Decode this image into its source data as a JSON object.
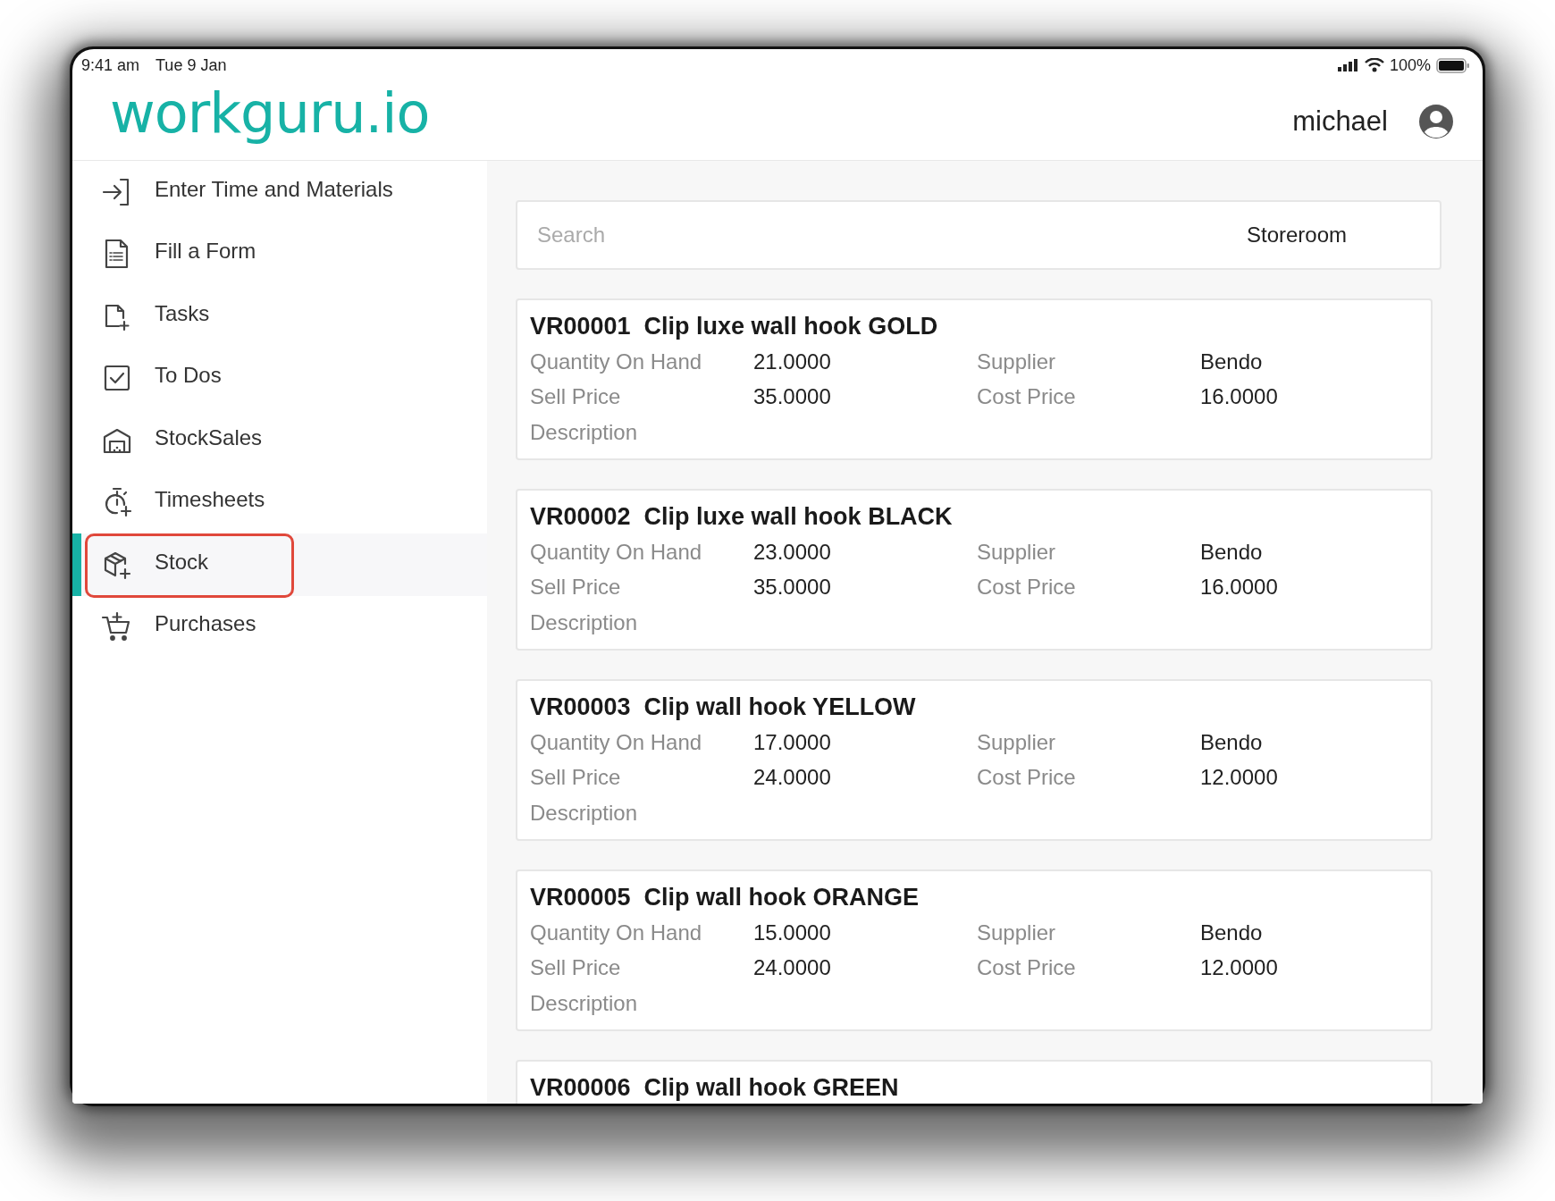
{
  "status_bar": {
    "time": "9:41 am",
    "date": "Tue 9 Jan",
    "battery": "100%"
  },
  "header": {
    "logo": "workguru.io",
    "user": "michael"
  },
  "sidebar": {
    "items": [
      {
        "label": "Enter Time and Materials",
        "selected": false,
        "highlighted": false
      },
      {
        "label": "Fill a Form",
        "selected": false,
        "highlighted": false
      },
      {
        "label": "Tasks",
        "selected": false,
        "highlighted": false
      },
      {
        "label": "To Dos",
        "selected": false,
        "highlighted": false
      },
      {
        "label": "StockSales",
        "selected": false,
        "highlighted": false
      },
      {
        "label": "Timesheets",
        "selected": false,
        "highlighted": false
      },
      {
        "label": "Stock",
        "selected": true,
        "highlighted": true
      },
      {
        "label": "Purchases",
        "selected": false,
        "highlighted": false
      }
    ]
  },
  "search": {
    "placeholder": "Search",
    "location": "Storeroom"
  },
  "items": [
    {
      "title": "VR00001  Clip luxe wall hook GOLD",
      "fields": [
        [
          "Quantity On Hand",
          "21.0000",
          "Supplier",
          "Bendo"
        ],
        [
          "Sell Price",
          "35.0000",
          "Cost Price",
          "16.0000"
        ],
        [
          "Description"
        ]
      ]
    },
    {
      "title": "VR00002  Clip luxe wall hook BLACK",
      "fields": [
        [
          "Quantity On Hand",
          "23.0000",
          "Supplier",
          "Bendo"
        ],
        [
          "Sell Price",
          "35.0000",
          "Cost Price",
          "16.0000"
        ],
        [
          "Description"
        ]
      ]
    },
    {
      "title": "VR00003  Clip wall hook YELLOW",
      "fields": [
        [
          "Quantity On Hand",
          "17.0000",
          "Supplier",
          "Bendo"
        ],
        [
          "Sell Price",
          "24.0000",
          "Cost Price",
          "12.0000"
        ],
        [
          "Description"
        ]
      ]
    },
    {
      "title": "VR00005  Clip wall hook ORANGE",
      "fields": [
        [
          "Quantity On Hand",
          "15.0000",
          "Supplier",
          "Bendo"
        ],
        [
          "Sell Price",
          "24.0000",
          "Cost Price",
          "12.0000"
        ],
        [
          "Description"
        ]
      ]
    },
    {
      "title": "VR00006  Clip wall hook GREEN"
    }
  ]
}
